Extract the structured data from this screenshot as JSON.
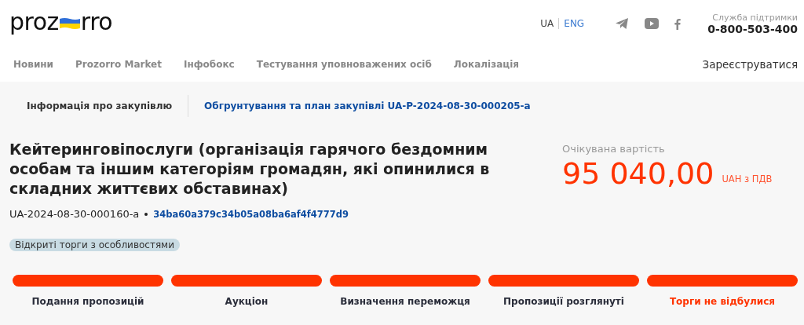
{
  "header": {
    "logo": {
      "left": "proz",
      "right": "rro"
    },
    "languages": [
      {
        "label": "UA",
        "selected": true
      },
      {
        "label": "ENG",
        "selected": false
      }
    ],
    "support": {
      "label": "Служба підтримки",
      "phone": "0-800-503-400"
    }
  },
  "nav": {
    "items": [
      "Новини",
      "Prozorro Market",
      "Інфобокс",
      "Тестування уповноважених осіб",
      "Локалізація"
    ],
    "register": "Зареєструватися"
  },
  "tabs": [
    {
      "label": "Інформація про закупівлю",
      "selected": true
    },
    {
      "label": "Обгрунтування та план закупівлі UA-P-2024-08-30-000205-a",
      "selected": false
    }
  ],
  "tender": {
    "title": "Кейтеринговіпослуги (організація гарячого бездомним особам та іншим категоріям громадян, які опинилися в складних життєвих обставинах)",
    "id": "UA-2024-08-30-000160-a",
    "hash": "34ba60a379c34b05a08ba6af4f4777d9",
    "procedure": "Відкриті торги з особливостями",
    "value": {
      "label": "Очікувана вартість",
      "amount": "95 040,00",
      "currency": "UAH з ПДВ"
    }
  },
  "stages": [
    {
      "label": "Подання пропозицій",
      "selected": false
    },
    {
      "label": "Аукціон",
      "selected": false
    },
    {
      "label": "Визначення переможця",
      "selected": false
    },
    {
      "label": "Пропозиції розглянуті",
      "selected": false
    },
    {
      "label": "Торги не відбулися",
      "selected": true
    }
  ]
}
